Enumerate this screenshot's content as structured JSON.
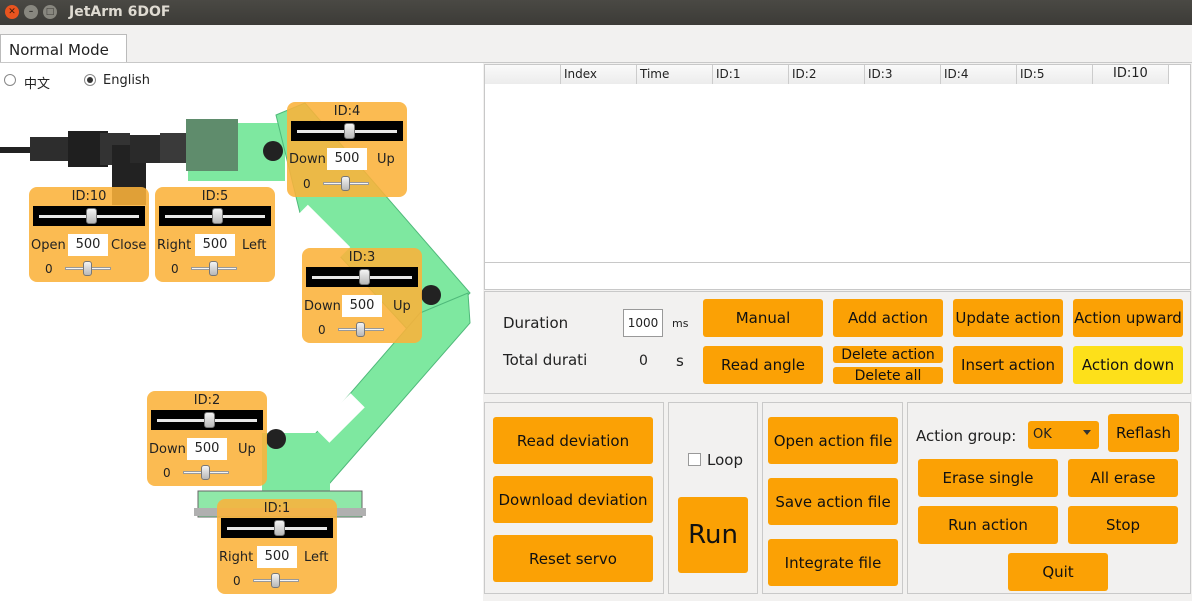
{
  "window": {
    "title": "JetArm 6DOF"
  },
  "tabs": [
    {
      "label": "Normal Mode"
    }
  ],
  "language": {
    "options": [
      "中文",
      "English"
    ],
    "selected": "English"
  },
  "servos": {
    "id4": {
      "id": "ID:4",
      "left": "Down",
      "right": "Up",
      "value": "500",
      "offset": "0",
      "level": 0.5
    },
    "id10": {
      "id": "ID:10",
      "left": "Open",
      "right": "Close",
      "value": "500",
      "offset": "0",
      "level": 0.5
    },
    "id5": {
      "id": "ID:5",
      "left": "Right",
      "right": "Left",
      "value": "500",
      "offset": "0",
      "level": 0.5
    },
    "id3": {
      "id": "ID:3",
      "left": "Down",
      "right": "Up",
      "value": "500",
      "offset": "0",
      "level": 0.5
    },
    "id2": {
      "id": "ID:2",
      "left": "Down",
      "right": "Up",
      "value": "500",
      "offset": "0",
      "level": 0.5
    },
    "id1": {
      "id": "ID:1",
      "left": "Right",
      "right": "Left",
      "value": "500",
      "offset": "0",
      "level": 0.5
    }
  },
  "table": {
    "columns": [
      "",
      "Index",
      "Time",
      "ID:1",
      "ID:2",
      "ID:3",
      "ID:4",
      "ID:5",
      "ID:10"
    ],
    "rows": []
  },
  "controls": {
    "duration_label": "Duration",
    "duration_value": "1000",
    "duration_unit": "ms",
    "total_label": "Total durati",
    "total_value": "0",
    "total_unit": "s",
    "manual": "Manual",
    "add_action": "Add action",
    "update_action": "Update action",
    "action_upward": "Action upward",
    "read_angle": "Read angle",
    "delete_action": "Delete action",
    "delete_all": "Delete all",
    "insert_action": "Insert action",
    "action_down": "Action down"
  },
  "deviation": {
    "read": "Read deviation",
    "download": "Download deviation",
    "reset": "Reset servo"
  },
  "run_section": {
    "loop_label": "Loop",
    "run": "Run"
  },
  "files": {
    "open": "Open action file",
    "save": "Save action file",
    "integrate": "Integrate file"
  },
  "action_group": {
    "label": "Action group:",
    "selected": "OK",
    "reflash": "Reflash",
    "erase_single": "Erase single",
    "all_erase": "All erase",
    "run_action": "Run action",
    "stop": "Stop",
    "quit": "Quit"
  },
  "colors": {
    "button": "#fba105",
    "button_highlight": "#fde01a",
    "servo_panel": "#fab23a",
    "arm_green": "#7ee8a0"
  }
}
